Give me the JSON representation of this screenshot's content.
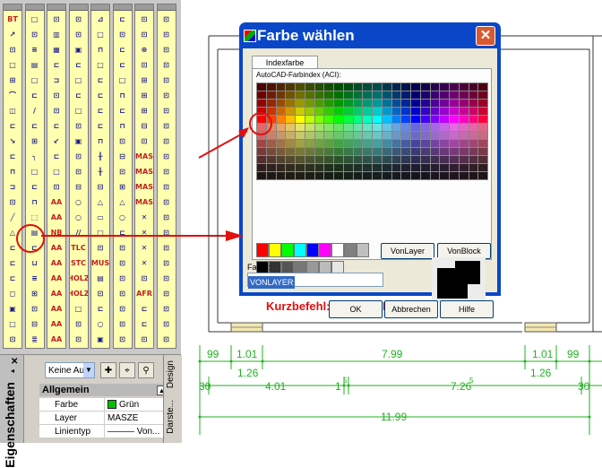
{
  "dialog": {
    "title": "Farbe wählen",
    "tab": "Indexfarbe",
    "aci_label": "AutoCAD-Farbindex (ACI):",
    "von_layer": "VonLayer",
    "von_block": "VonBlock",
    "farbe_label": "Farbe:",
    "farbe_value": "VONLAYER",
    "ok": "OK",
    "cancel": "Abbrechen",
    "help": "Hilfe",
    "close_icon": "close-icon"
  },
  "annotation": {
    "kurzbefehl": "Kurzbefehl: MZ [MAZFAR]"
  },
  "palette": {
    "columns": [
      [
        "BT",
        "↗",
        "⊡",
        "□",
        "⊞",
        "⌒",
        "◫",
        "⊏",
        "↘",
        "⊏",
        "⊓",
        "⊐",
        "⊡",
        "╱",
        "△",
        "⊏",
        "⊏",
        "⊏",
        "◻",
        "▣",
        "□",
        "⊡"
      ],
      [
        "□",
        "⊡",
        "≡",
        "▤",
        "□",
        "⊏",
        "∕",
        "⊏",
        "⊞",
        "╮",
        "□",
        "⊏",
        "⊓",
        "⬚",
        "▤",
        "⊏",
        "⊔",
        "≡",
        "⊞",
        "⊡",
        "⊟",
        "≣"
      ],
      [
        "⊡",
        "▥",
        "▦",
        "⊏",
        "⊐",
        "⊡",
        "⊡",
        "⊏",
        "↙",
        "⊏",
        "□",
        "⊡",
        "AA",
        "AA",
        "NB",
        "AA",
        "AA",
        "AA",
        "AA",
        "AA",
        "AA",
        "AA"
      ],
      [
        "⊡",
        "⊡",
        "▣",
        "⊏",
        "□",
        "⊏",
        "□",
        "⊡",
        "▣",
        "⊡",
        "⊡",
        "⊟",
        "○",
        "○",
        "∕∕",
        "TLC",
        "STC",
        "HOLZ",
        "HOLZ",
        "□",
        "⊡",
        "⊡"
      ],
      [
        "⊿",
        "□",
        "⊓",
        "□",
        "⊏",
        "⊏",
        "⊏",
        "⊏",
        "⊓",
        "╫",
        "╫",
        "⊟",
        "△",
        "▭",
        "□",
        "⊡",
        "MUS",
        "▤",
        "⊡",
        "⊏",
        "○",
        "▣"
      ],
      [
        "⊏",
        "⊡",
        "⊏",
        "⊏",
        "□",
        "⊓",
        "⊏",
        "⊓",
        "⊡",
        "⊟",
        "⊡",
        "⊞",
        "△",
        "○",
        "⊏",
        "⊡",
        "⊡",
        "⊡",
        "⊡",
        "⊡",
        "⊡",
        "⊡"
      ],
      [
        "⊡",
        "⊡",
        "⊕",
        "⊡",
        "⊞",
        "⊞",
        "⊞",
        "⊟",
        "⊡",
        "MAS",
        "MAS",
        "MAS",
        "MAS",
        "✕",
        "✕",
        "✕",
        "✕",
        "⊡",
        "AFR",
        "⊏",
        "⊏",
        "⊡"
      ],
      [
        "⊡",
        "⊡",
        "⊡",
        "⊡",
        "⊡",
        "⊡",
        "⊡",
        "⊡",
        "⊡",
        "⊡",
        "⊡",
        "⊡",
        "⊡",
        "⊡",
        "⊡",
        "⊡",
        "⊡",
        "⊡",
        "⊡",
        "⊡",
        "⊡",
        "⊡"
      ]
    ]
  },
  "properties": {
    "panel_title": "Eigenschaften",
    "selection": "Keine Au",
    "group": "Allgemein",
    "rows": [
      {
        "key": "Farbe",
        "value": "Grün"
      },
      {
        "key": "Layer",
        "value": "MASZE"
      },
      {
        "key": "Linientyp",
        "value": "——— Von..."
      }
    ],
    "tab_design": "Design",
    "tab_darst": "Darste..."
  },
  "dimensions": {
    "row1": [
      "99",
      "1.01",
      "7.99",
      "1.01",
      "99"
    ],
    "row1b": [
      "1.26",
      "1.26"
    ],
    "row2": [
      "30",
      "4.01",
      "1",
      "7.26",
      "30"
    ],
    "row2_sup": [
      "5",
      "5"
    ],
    "row3": [
      "11.99"
    ]
  },
  "colors": {
    "accent_red": "#e01010",
    "dimension_green": "#22b222",
    "title_bar": "#0a47c8"
  }
}
